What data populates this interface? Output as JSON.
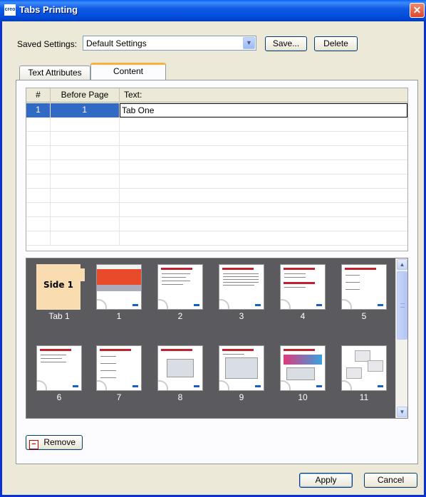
{
  "window": {
    "title": "Tabs Printing",
    "app_icon_text": "creo"
  },
  "saved_settings": {
    "label": "Saved Settings:",
    "selected": "Default Settings",
    "save_button": "Save...",
    "delete_button": "Delete"
  },
  "tabs": [
    {
      "label": "Text Attributes",
      "active": false
    },
    {
      "label": "Content",
      "active": true
    }
  ],
  "grid": {
    "columns": [
      "#",
      "Before Page",
      "Text:"
    ],
    "rows": [
      {
        "num": "1",
        "before_page": "1",
        "text": "Tab One",
        "selected": true
      }
    ]
  },
  "thumbnails": {
    "tab_card": {
      "text": "Side 1",
      "label": "Tab 1"
    },
    "pages": [
      "1",
      "2",
      "3",
      "4",
      "5",
      "6",
      "7",
      "8",
      "9",
      "10",
      "11"
    ]
  },
  "remove_button": "Remove",
  "apply_button": "Apply",
  "cancel_button": "Cancel",
  "colors": {
    "titlebar": "#0054e3",
    "selection": "#316ac5",
    "thumb_bg": "#5b5b5f",
    "tab_card": "#f9ddb0",
    "active_tab_accent": "#f8b33d"
  }
}
